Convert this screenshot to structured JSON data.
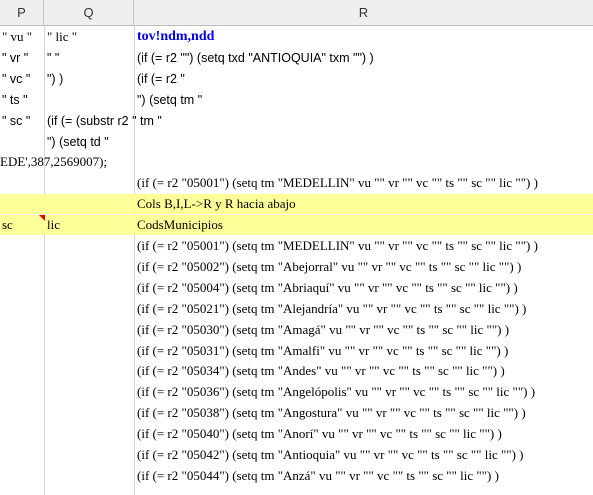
{
  "columns": [
    {
      "label": "P"
    },
    {
      "label": "Q"
    },
    {
      "label": "R"
    }
  ],
  "rows": [
    {
      "p": "\" vu \"",
      "q": "\" lic \"",
      "r": "tov!ndm,ndd",
      "r_style": "blue"
    },
    {
      "p": "\" vr \"",
      "q": "\"  \"",
      "r": "(if (= r2 \"\") (setq txd \"ANTIOQUIA\" txm \"\") )",
      "r_style": "sans"
    },
    {
      "p": "\" vc \"",
      "q": "\") )",
      "r": "(if (= r2 \"",
      "r_style": "sans"
    },
    {
      "p": "\" ts \"",
      "q": "",
      "r": "\") (setq tm \"",
      "r_style": "sans"
    },
    {
      "p": "\" sc \"",
      "q": "(if (= (substr r2 \" tm \"",
      "r": "",
      "r_style": "sans"
    },
    {
      "p": "",
      "q": "\") (setq td \"",
      "r": "",
      "r_style": "sans"
    },
    {
      "p": "EDE',387,2569007);",
      "q": "",
      "r": "",
      "r_style": "serif",
      "p_overflow": true
    },
    {
      "p": "",
      "q": "",
      "r": "(if (= r2 \"05001\") (setq tm \"MEDELLIN\" vu \"\" vr \"\" vc \"\" ts \"\" sc \"\" lic \"\") )",
      "r_style": "serif"
    },
    {
      "p": "",
      "q": "",
      "r": "Cols B,I,L->R y R hacia abajo",
      "r_style": "serif",
      "highlight": true
    },
    {
      "p": "sc",
      "q": "lic",
      "r": "CodsMunicipios",
      "r_style": "serif",
      "highlight": true
    },
    {
      "p": "",
      "q": "",
      "r": "(if (= r2 \"05001\") (setq tm \"MEDELLIN\" vu \"\" vr \"\" vc \"\" ts \"\" sc \"\" lic \"\") )",
      "r_style": "serif"
    },
    {
      "p": "",
      "q": "",
      "r": "(if (= r2 \"05002\") (setq tm \"Abejorral\" vu \"\" vr \"\" vc \"\" ts \"\" sc \"\" lic \"\") )",
      "r_style": "serif"
    },
    {
      "p": "",
      "q": "",
      "r": "(if (= r2 \"05004\") (setq tm \"Abriaquí\" vu \"\" vr \"\" vc \"\" ts \"\" sc \"\" lic \"\") )",
      "r_style": "serif"
    },
    {
      "p": "",
      "q": "",
      "r": "(if (= r2 \"05021\") (setq tm \"Alejandría\" vu \"\" vr \"\" vc \"\" ts \"\" sc \"\" lic \"\") )",
      "r_style": "serif"
    },
    {
      "p": "",
      "q": "",
      "r": "(if (= r2 \"05030\") (setq tm \"Amagá\" vu \"\" vr \"\" vc \"\" ts \"\" sc \"\" lic \"\") )",
      "r_style": "serif"
    },
    {
      "p": "",
      "q": "",
      "r": "(if (= r2 \"05031\") (setq tm \"Amalfi\" vu \"\" vr \"\" vc \"\" ts \"\" sc \"\" lic \"\") )",
      "r_style": "serif"
    },
    {
      "p": "",
      "q": "",
      "r": "(if (= r2 \"05034\") (setq tm \"Andes\" vu \"\" vr \"\" vc \"\" ts \"\" sc \"\" lic \"\") )",
      "r_style": "serif"
    },
    {
      "p": "",
      "q": "",
      "r": "(if (= r2 \"05036\") (setq tm \"Angelópolis\" vu \"\" vr \"\" vc \"\" ts \"\" sc \"\" lic \"\") )",
      "r_style": "serif"
    },
    {
      "p": "",
      "q": "",
      "r": "(if (= r2 \"05038\") (setq tm \"Angostura\" vu \"\" vr \"\" vc \"\" ts \"\" sc \"\" lic \"\") )",
      "r_style": "serif"
    },
    {
      "p": "",
      "q": "",
      "r": "(if (= r2 \"05040\") (setq tm \"Anorí\" vu \"\" vr \"\" vc \"\" ts \"\" sc \"\" lic \"\") )",
      "r_style": "serif"
    },
    {
      "p": "",
      "q": "",
      "r": "(if (= r2 \"05042\") (setq tm \"Antioquia\" vu \"\" vr \"\" vc \"\" ts \"\" sc \"\" lic \"\") )",
      "r_style": "serif"
    },
    {
      "p": "",
      "q": "",
      "r": "(if (= r2 \"05044\") (setq tm \"Anzá\" vu \"\" vr \"\" vc \"\" ts \"\" sc \"\" lic \"\") )",
      "r_style": "serif"
    }
  ],
  "comment_marker_color": "#e00000",
  "highlight_color": "#ffff99"
}
